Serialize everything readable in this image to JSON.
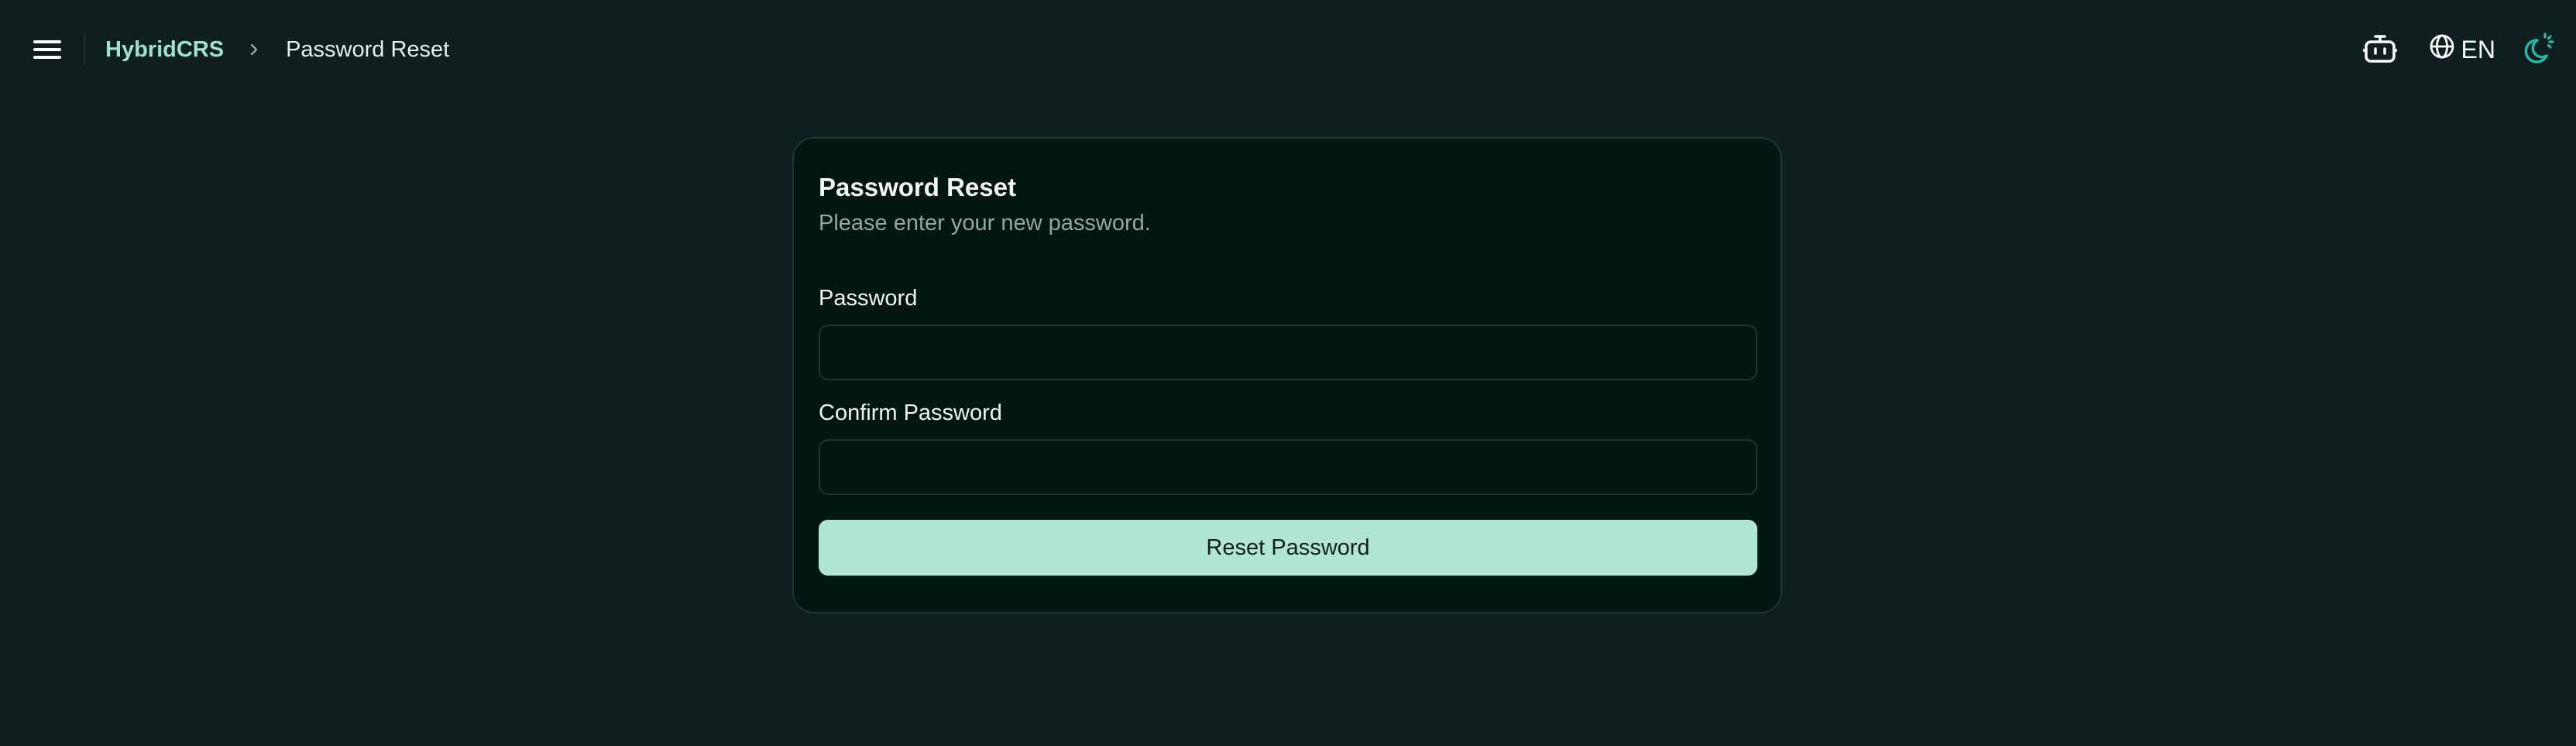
{
  "header": {
    "menu_icon": "hamburger-menu-icon",
    "breadcrumb": {
      "home": "HybridCRS",
      "separator_icon": "chevron-right-icon",
      "current": "Password Reset"
    },
    "actions": {
      "bot_icon": "robot-icon",
      "language_icon": "globe-icon",
      "language_label": "EN",
      "theme_icon": "moon-sun-icon"
    }
  },
  "form": {
    "title": "Password Reset",
    "subtitle": "Please enter your new password.",
    "password_label": "Password",
    "password_value": "",
    "confirm_label": "Confirm Password",
    "confirm_value": "",
    "submit_label": "Reset Password"
  },
  "colors": {
    "background": "#0e1f1e",
    "card_background": "#021612",
    "accent": "#9fe2cf",
    "button": "#b1e5d4",
    "theme_icon": "#2bb5a8"
  }
}
